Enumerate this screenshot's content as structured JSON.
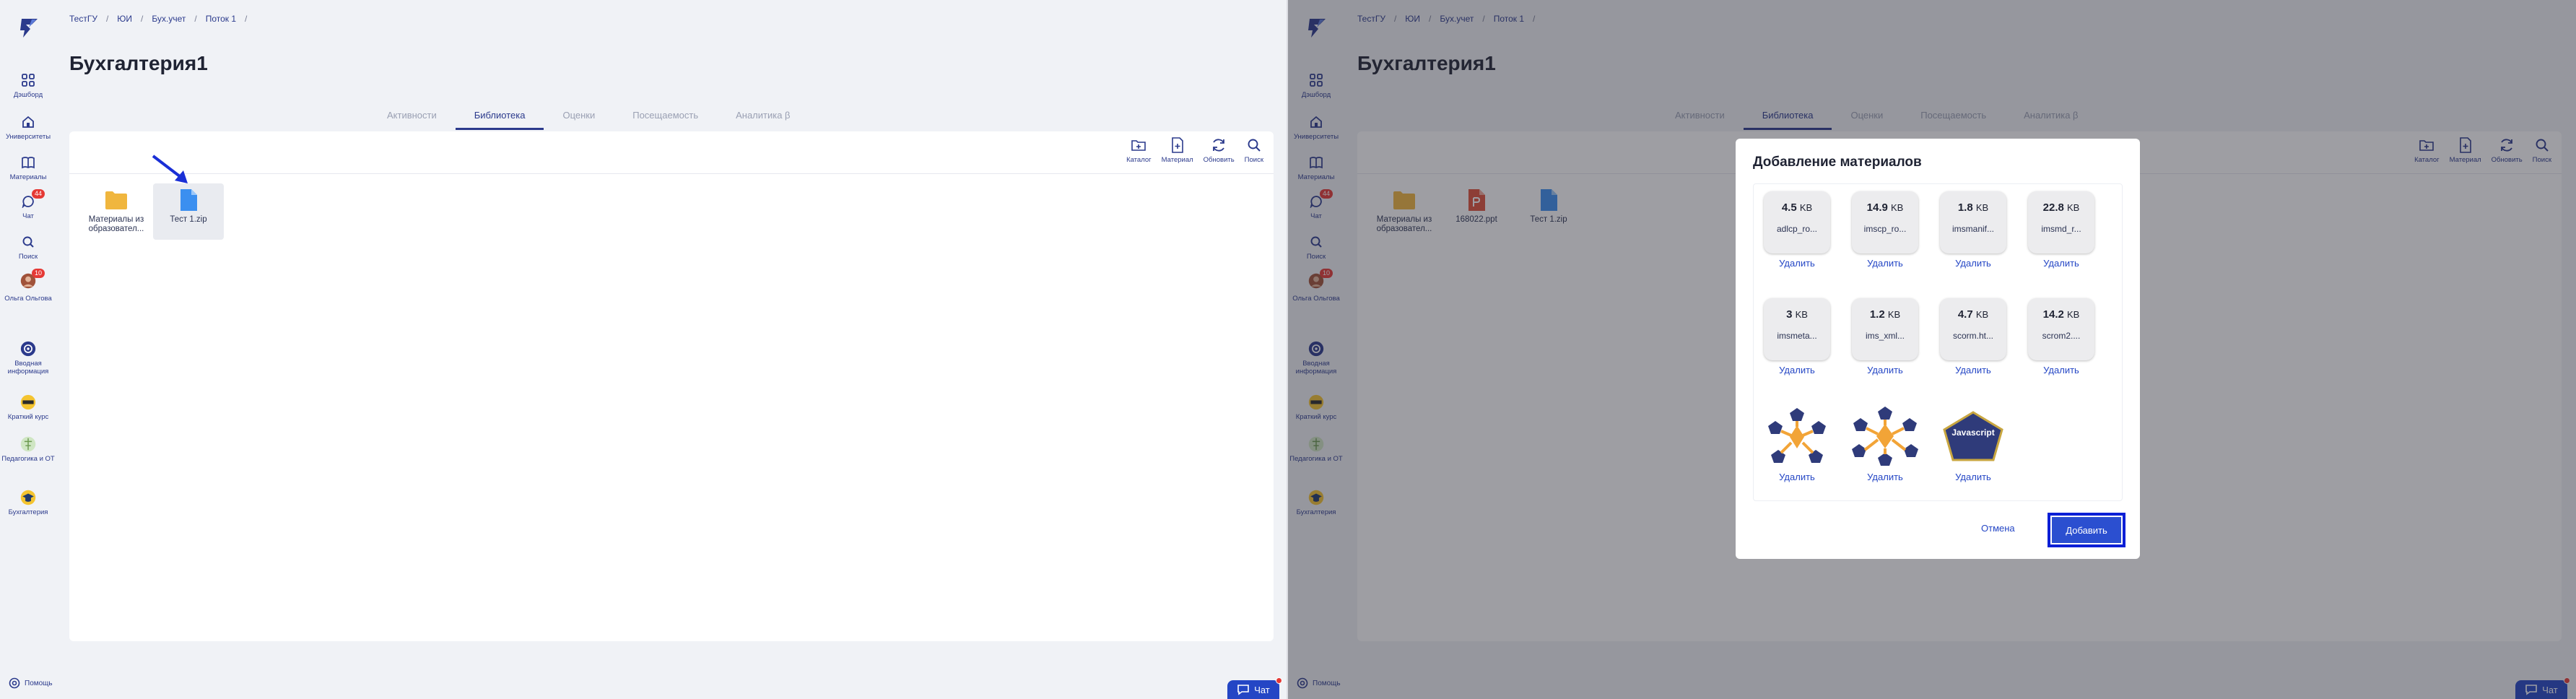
{
  "screens": [
    {
      "breadcrumb": [
        "ТестГУ",
        "ЮИ",
        "Бух.учет",
        "Поток 1"
      ],
      "title": "Бухгалтерия1",
      "tabs": [
        "Активности",
        "Библиотека",
        "Оценки",
        "Посещаемость",
        "Аналитика β"
      ],
      "active_tab": "Библиотека",
      "files": [
        {
          "label": "Материалы из образовател...",
          "icon": "folder-icon"
        },
        {
          "label": "Тест 1.zip",
          "icon": "file-icon",
          "selected": true
        }
      ]
    },
    {
      "breadcrumb": [
        "ТестГУ",
        "ЮИ",
        "Бух.учет",
        "Поток 1"
      ],
      "title": "Бухгалтерия1",
      "tabs": [
        "Активности",
        "Библиотека",
        "Оценки",
        "Посещаемость",
        "Аналитика β"
      ],
      "active_tab": "Библиотека",
      "files": [
        {
          "label": "Материалы из образовател...",
          "icon": "folder-icon"
        },
        {
          "label": "168022.ppt",
          "icon": "ppt-icon"
        },
        {
          "label": "Тест 1.zip",
          "icon": "file-icon"
        }
      ]
    }
  ],
  "sidebar": {
    "items": [
      {
        "label": "Дэшборд",
        "icon": "dashboard-icon"
      },
      {
        "label": "Университеты",
        "icon": "university-icon"
      },
      {
        "label": "Материалы",
        "icon": "book-icon"
      },
      {
        "label": "Чат",
        "icon": "chat-icon",
        "badge": "44"
      },
      {
        "label": "Поиск",
        "icon": "search-icon"
      },
      {
        "label": "Ольга Ольгова",
        "icon": "avatar",
        "badge": "10"
      }
    ],
    "courses": [
      {
        "label": "Вводная информация",
        "color": "#2b3a8c"
      },
      {
        "label": "Краткий курс",
        "color": "#c9a400"
      },
      {
        "label": "Педагогика и ОТ",
        "color": "#8bc34a"
      },
      {
        "label": "Бухгалтерия",
        "color": "#1f4e8c"
      }
    ]
  },
  "tools": [
    "Каталог",
    "Материал",
    "Обновить",
    "Поиск"
  ],
  "help_label": "Помощь",
  "chat_label": "Чат",
  "modal": {
    "title": "Добавление материалов",
    "delete_label": "Удалить",
    "files": [
      {
        "size": "4.5",
        "unit": "KB",
        "name": "adlcp_ro..."
      },
      {
        "size": "14.9",
        "unit": "KB",
        "name": "imscp_ro..."
      },
      {
        "size": "1.8",
        "unit": "KB",
        "name": "imsmanif..."
      },
      {
        "size": "22.8",
        "unit": "KB",
        "name": "imsmd_r..."
      },
      {
        "size": "3",
        "unit": "KB",
        "name": "imsmeta..."
      },
      {
        "size": "1.2",
        "unit": "KB",
        "name": "ims_xml..."
      },
      {
        "size": "4.7",
        "unit": "KB",
        "name": "scorm.ht..."
      },
      {
        "size": "14.2",
        "unit": "KB",
        "name": "scrom2...."
      }
    ],
    "images": [
      {
        "icon": "diagram-thumbnail"
      },
      {
        "icon": "diagram-thumbnail"
      },
      {
        "icon": "javascript-thumbnail",
        "text": "Javascript"
      }
    ],
    "cancel_label": "Отмена",
    "add_label": "Добавить"
  }
}
